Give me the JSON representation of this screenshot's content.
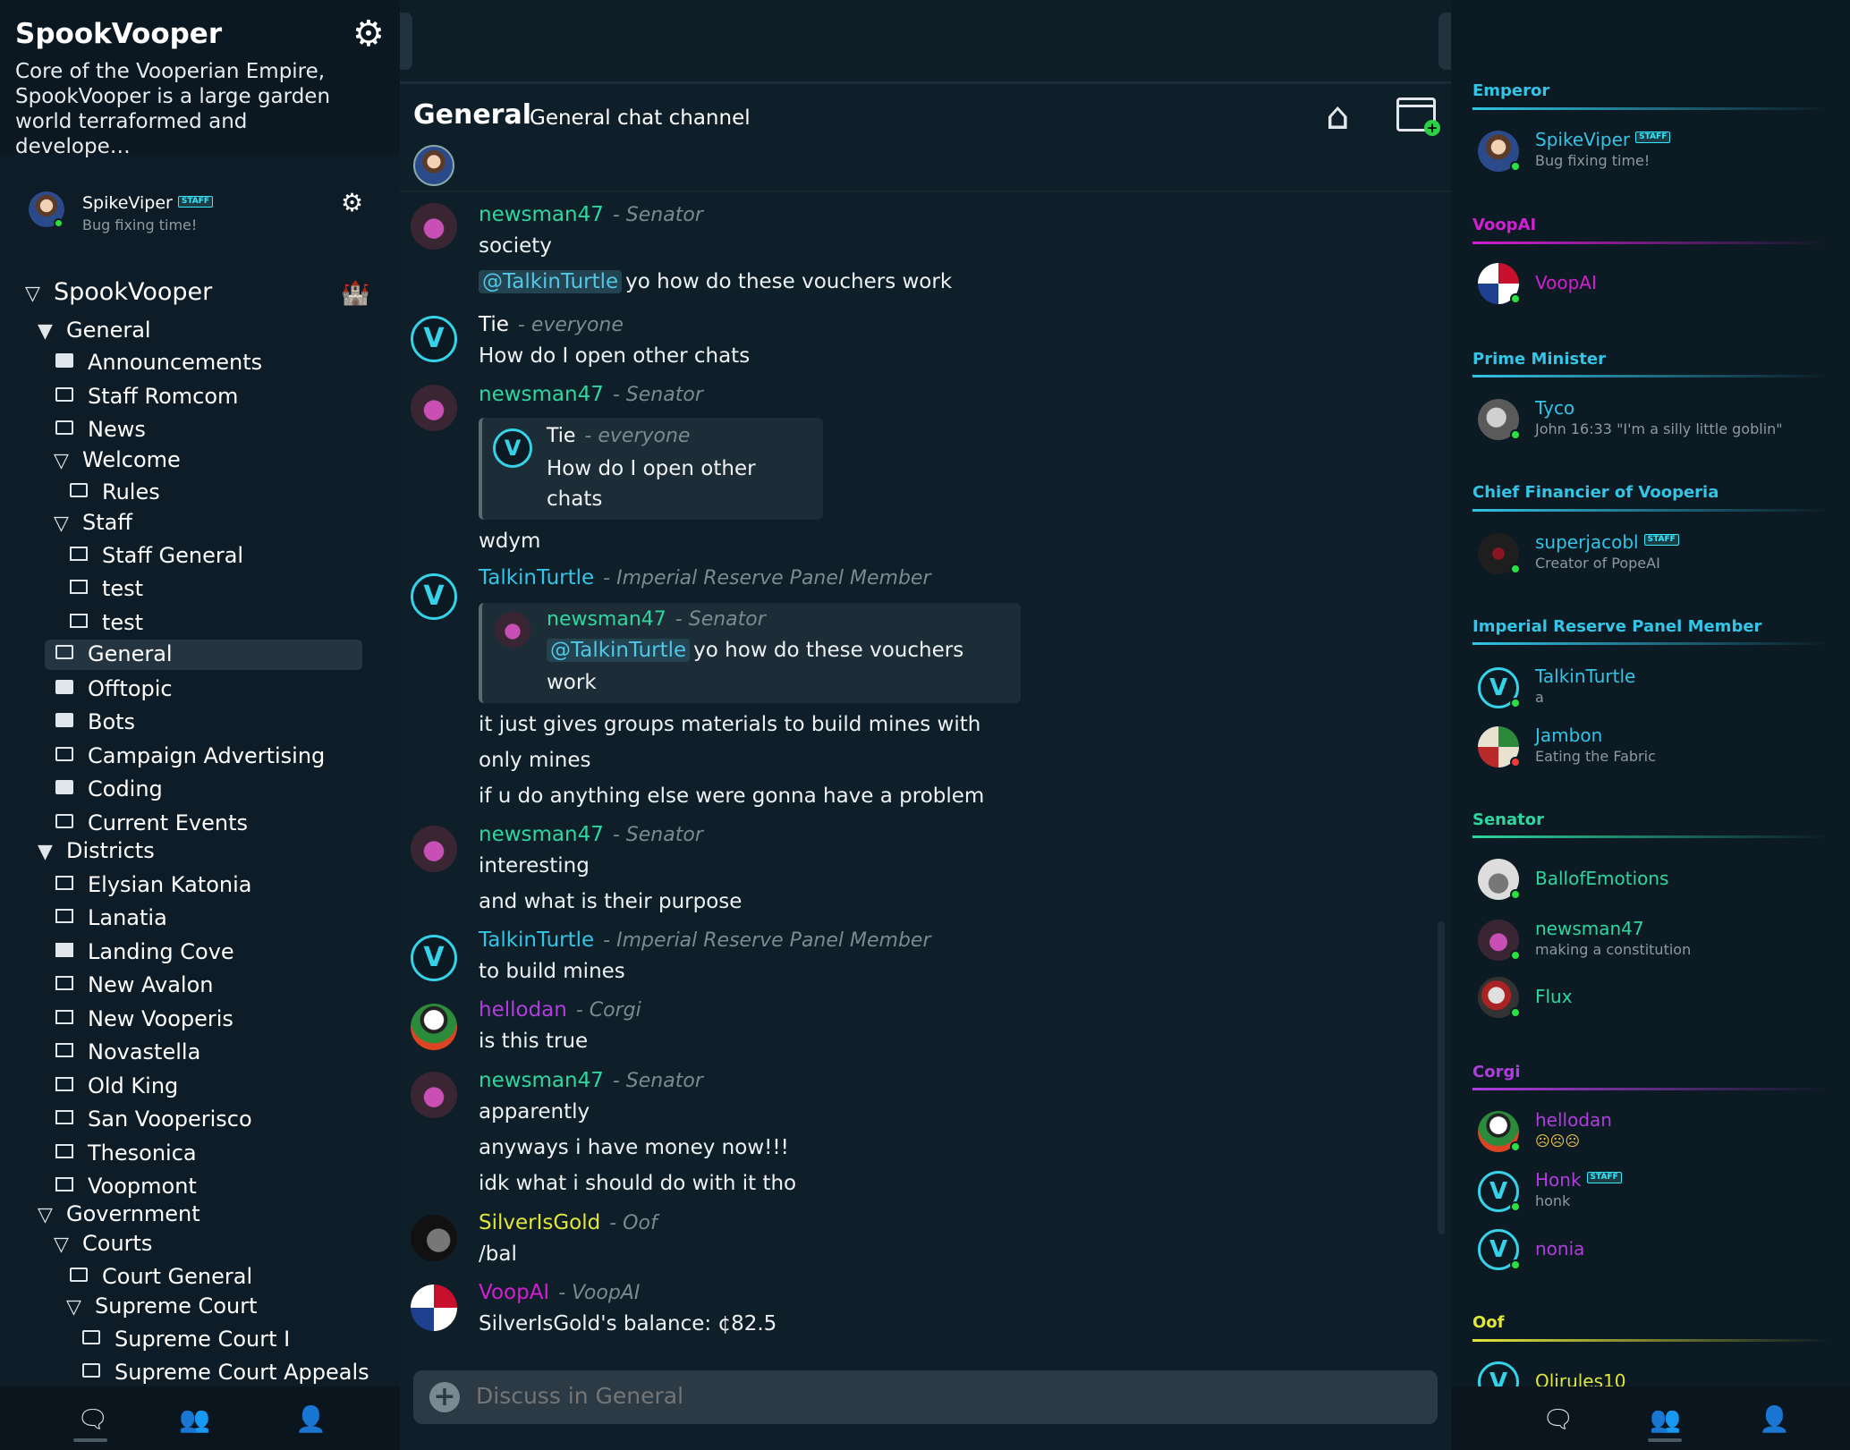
{
  "planet": {
    "name": "SpookVooper",
    "description": "Core of the Vooperian Empire, SpookVooper is a large garden world terraformed and develope…"
  },
  "me": {
    "name": "SpikeViper",
    "badge": "STAFF",
    "status": "Bug fixing time!"
  },
  "tree": {
    "planet": "SpookVooper",
    "items": [
      {
        "label": "General"
      },
      {
        "label": "Announcements"
      },
      {
        "label": "Staff Romcom"
      },
      {
        "label": "News"
      },
      {
        "label": "Welcome"
      },
      {
        "label": "Rules"
      },
      {
        "label": "Staff"
      },
      {
        "label": "Staff General"
      },
      {
        "label": "test"
      },
      {
        "label": "test"
      },
      {
        "label": "General"
      },
      {
        "label": "Offtopic"
      },
      {
        "label": "Bots"
      },
      {
        "label": "Campaign Advertising"
      },
      {
        "label": "Coding"
      },
      {
        "label": "Current Events"
      },
      {
        "label": "Districts"
      },
      {
        "label": "Elysian Katonia"
      },
      {
        "label": "Lanatia"
      },
      {
        "label": "Landing Cove"
      },
      {
        "label": "New Avalon"
      },
      {
        "label": "New Vooperis"
      },
      {
        "label": "Novastella"
      },
      {
        "label": "Old King"
      },
      {
        "label": "San Vooperisco"
      },
      {
        "label": "Thesonica"
      },
      {
        "label": "Voopmont"
      },
      {
        "label": "Government"
      },
      {
        "label": "Courts"
      },
      {
        "label": "Court General"
      },
      {
        "label": "Supreme Court"
      },
      {
        "label": "Supreme Court I"
      },
      {
        "label": "Supreme Court Appeals"
      }
    ]
  },
  "channel": {
    "name": "General",
    "description": "General chat channel"
  },
  "messages": {
    "m1": {
      "name": "newsman47",
      "role": "- Senator",
      "lines": [
        "society"
      ],
      "mention": "@TalkinTurtle",
      "mention_rest": "yo how do these vouchers work"
    },
    "m2": {
      "name": "Tie",
      "role": "- everyone",
      "lines": [
        "How do I open other chats"
      ]
    },
    "m3": {
      "name": "newsman47",
      "role": "- Senator",
      "quote_name": "Tie",
      "quote_role": "- everyone",
      "quote_line1": "How do I open other",
      "quote_line2": "chats",
      "lines": [
        "wdym"
      ]
    },
    "m4": {
      "name": "TalkinTurtle",
      "role": "- Imperial Reserve Panel Member",
      "quote_name": "newsman47",
      "quote_role": "- Senator",
      "quote_mention": "@TalkinTurtle",
      "quote_rest": "yo how do these vouchers",
      "quote_line2": "work",
      "lines": [
        "it just gives groups materials to build mines with",
        "only mines",
        "if u do anything else were gonna have a problem"
      ]
    },
    "m5": {
      "name": "newsman47",
      "role": "- Senator",
      "lines": [
        "interesting",
        "and what is their purpose"
      ]
    },
    "m6": {
      "name": "TalkinTurtle",
      "role": "- Imperial Reserve Panel Member",
      "lines": [
        "to build mines"
      ]
    },
    "m7": {
      "name": "hellodan",
      "role": "- Corgi",
      "lines": [
        "is this true"
      ]
    },
    "m8": {
      "name": "newsman47",
      "role": "- Senator",
      "lines": [
        "apparently",
        "anyways i have money now!!!",
        "idk what i should do with it tho"
      ]
    },
    "m9": {
      "name": "SilverIsGold",
      "role": "- Oof",
      "lines": [
        "/bal"
      ]
    },
    "m10": {
      "name": "VoopAI",
      "role": "- VoopAI",
      "lines": [
        "SilverIsGold's balance: ¢82.5"
      ]
    }
  },
  "composer": {
    "placeholder": "Discuss in General"
  },
  "members": {
    "roles": [
      {
        "name": "Emperor",
        "color": "#33c4e6"
      },
      {
        "name": "VoopAI",
        "color": "#d21fd2"
      },
      {
        "name": "Prime Minister",
        "color": "#33c4e6"
      },
      {
        "name": "Chief Financier of Vooperia",
        "color": "#33c4e6"
      },
      {
        "name": "Imperial Reserve Panel Member",
        "color": "#33c4e6"
      },
      {
        "name": "Senator",
        "color": "#2fd6a0"
      },
      {
        "name": "Corgi",
        "color": "#b13dde"
      },
      {
        "name": "Oof",
        "color": "#e3e63a"
      }
    ],
    "list": [
      {
        "name": "SpikeViper",
        "badge": "STAFF",
        "status": "Bug fixing time!"
      },
      {
        "name": "VoopAI",
        "status": ""
      },
      {
        "name": "Tyco",
        "status": "John 16:33 \"I'm a silly little goblin\""
      },
      {
        "name": "superjacobl",
        "badge": "STAFF",
        "status": "Creator of PopeAI"
      },
      {
        "name": "TalkinTurtle",
        "status": "a"
      },
      {
        "name": "Jambon",
        "status": "Eating the Fabric"
      },
      {
        "name": "BallofEmotions",
        "status": ""
      },
      {
        "name": "newsman47",
        "status": "making a constitution"
      },
      {
        "name": "Flux",
        "status": ""
      },
      {
        "name": "hellodan",
        "status": "☹☹☹"
      },
      {
        "name": "Honk",
        "badge": "STAFF",
        "status": "honk"
      },
      {
        "name": "nonia",
        "status": ""
      },
      {
        "name": "Olirules10",
        "status": ""
      }
    ]
  },
  "colors": {
    "senator": "#2fd6a0",
    "turtle": "#33c4e6",
    "corgi": "#b13dde",
    "oof": "#e3e63a",
    "voopai": "#d21fd2",
    "emperor": "#33c4e6"
  },
  "icons": [
    "gear-icon",
    "home-icon",
    "new-window-icon",
    "chat-icon",
    "members-icon",
    "profile-icon",
    "plus-icon"
  ]
}
